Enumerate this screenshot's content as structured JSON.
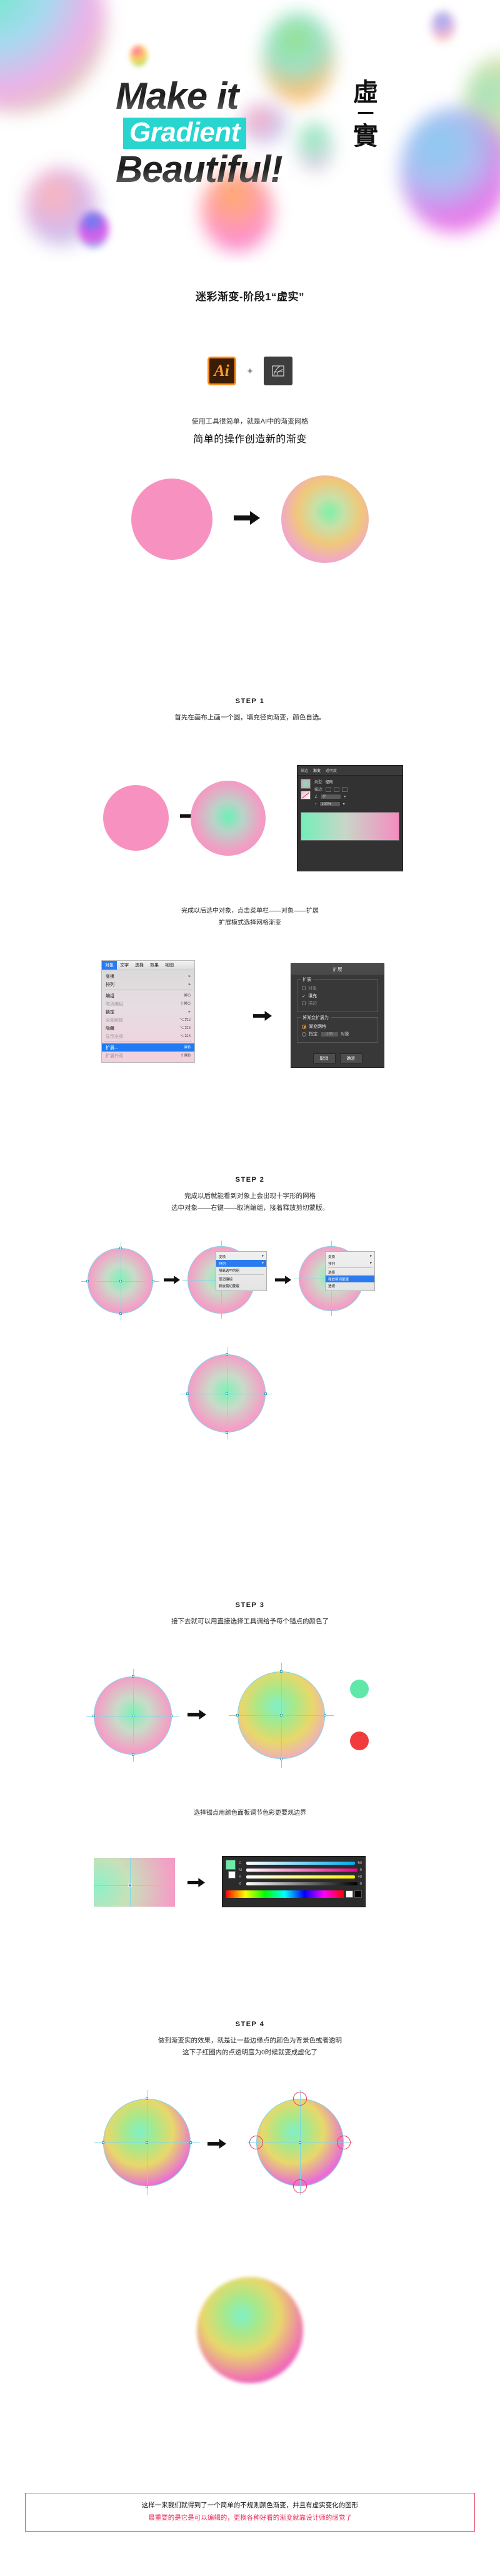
{
  "hero": {
    "line1": "Make it",
    "line2": "Gradient",
    "line3": "Beautiful!",
    "cn_char1": "虛",
    "cn_char2": "一",
    "cn_char3": "實",
    "accent_color": "#28d6cf"
  },
  "section_title": "迷彩渐变-阶段1“虚实”",
  "tools": {
    "ai_label": "Ai",
    "plus": "+",
    "mesh_icon_name": "gradient-mesh-icon",
    "caption_small": "使用工具很简单，就是AI中的渐变网格",
    "caption_big": "简单的操作创造新的渐变"
  },
  "steps": [
    {
      "label": "STEP 1",
      "desc": "首先在画布上画一个圆，填充径向渐变，颜色自选。"
    },
    {
      "label": "STEP 2",
      "desc": "完成以后就能看到对象上会出现十字形的网格\n选中对象——右键——取消编组，接着释放剪切蒙版。"
    },
    {
      "label": "STEP 3",
      "desc": "接下去就可以用直接选择工具调给予每个锚点的颜色了"
    },
    {
      "label": "STEP 4",
      "desc": "做到渐变实的效果，就是让一些边缘点的颜色为背景色或者透明\n这下子红圈内的点透明度为0时候就变成虚化了"
    }
  ],
  "notes": {
    "after_step1": "完成以后选中对象，点击菜单栏——对象——扩展\n扩展模式选择网格渐变",
    "after_step3": "选择锚点用颜色面板调节色彩更要观边界"
  },
  "gradient_panel": {
    "tabs": [
      "描边",
      "渐变",
      "透明度"
    ],
    "active_tab": "渐变",
    "type_label": "类型:",
    "type_value": "径向",
    "stroke_label": "描边:",
    "angle_value": "0°",
    "opacity_value": "100%",
    "gradient_from": "#73efb8",
    "gradient_to": "#f58cc0"
  },
  "menu": {
    "menubar": [
      "对象",
      "文字",
      "选择",
      "效果",
      "视图"
    ],
    "selected_menubar": "对象",
    "items": [
      {
        "label": "变换",
        "shortcut": "▸",
        "state": "normal"
      },
      {
        "label": "排列",
        "shortcut": "▸",
        "state": "normal"
      },
      {
        "sep": true
      },
      {
        "label": "编组",
        "shortcut": "⌘G",
        "state": "normal"
      },
      {
        "label": "取消编组",
        "shortcut": "⇧⌘G",
        "state": "dim"
      },
      {
        "label": "锁定",
        "shortcut": "▸",
        "state": "normal"
      },
      {
        "label": "全部解锁",
        "shortcut": "⌥⌘2",
        "state": "dim"
      },
      {
        "label": "隐藏",
        "shortcut": "⌥⌘3",
        "state": "normal"
      },
      {
        "label": "显示全部",
        "shortcut": "⌥⌘3",
        "state": "dim"
      },
      {
        "sep": true
      },
      {
        "label": "扩展...",
        "shortcut": "⌘B",
        "state": "highlight"
      },
      {
        "label": "扩展外观",
        "shortcut": "⇧⌘B",
        "state": "dim"
      }
    ]
  },
  "expand_dialog": {
    "title": "扩展",
    "group1_label": "扩展",
    "checkboxes": [
      {
        "label": "对象",
        "checked": false,
        "enabled": false
      },
      {
        "label": "填充",
        "checked": true,
        "enabled": true
      },
      {
        "label": "描边",
        "checked": false,
        "enabled": false
      }
    ],
    "group2_label": "将渐变扩展为",
    "radios": [
      {
        "label": "渐变网格",
        "selected": true
      },
      {
        "label": "指定:",
        "selected": false
      }
    ],
    "specify_value": "255",
    "specify_suffix": "对象",
    "cancel_button": "取消",
    "ok_button": "确定"
  },
  "footer": {
    "line1": "这样一来我们就得到了一个简单的不规则颜色渐变，并且有虚实变化的图形",
    "line2": "最重要的是它是可以编辑的，更换各种好看的渐变就靠设计师的感觉了"
  },
  "colors": {
    "pink": "#f792c0",
    "mint": "#6ef0b6",
    "cyan_accent": "#28d6cf",
    "ai_orange": "#ff8f1c",
    "red": "#ec2d58",
    "mesh_grid": "#7fd7e8"
  }
}
